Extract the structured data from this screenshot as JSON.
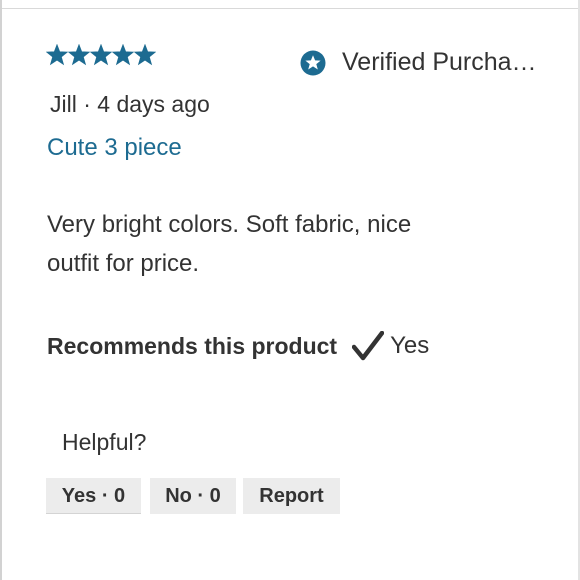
{
  "review": {
    "rating": 5,
    "rating_max": 5,
    "star_color": "#1d6b91",
    "verified_label": "Verified Purcha…",
    "reviewer_line": "Jill · 4 days ago",
    "title": "Cute 3 piece",
    "title_color": "#1d6b91",
    "body": "Very bright colors. Soft fabric, nice outfit for price.",
    "recommends_label": "Recommends this product",
    "recommends_value": "Yes",
    "helpful_label": "Helpful?",
    "yes_button": "Yes · 0",
    "no_button": "No · 0",
    "report_button": "Report"
  },
  "icons": {
    "star": "star-icon",
    "verified": "verified-star-badge-icon",
    "check": "checkmark-icon"
  }
}
